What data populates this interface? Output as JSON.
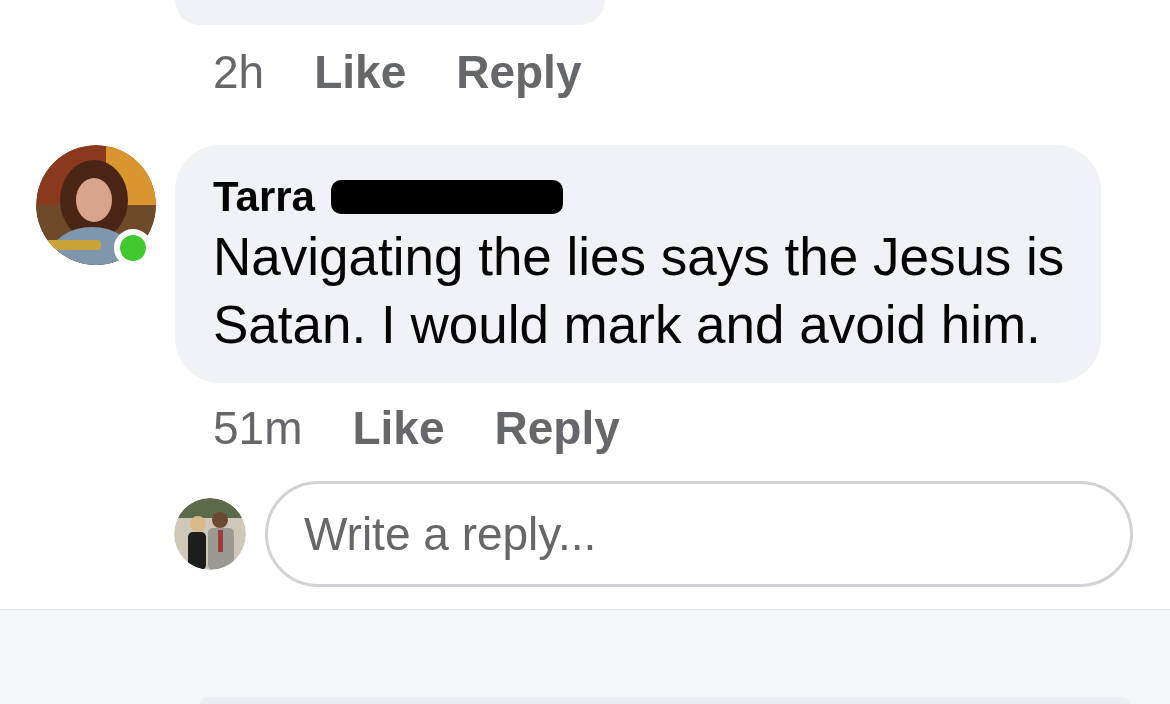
{
  "previous_comment": {
    "time": "2h",
    "actions": [
      "Like",
      "Reply"
    ]
  },
  "comment": {
    "author": "Tarra",
    "author_redacted": true,
    "online": true,
    "text": "Navigating the lies says the Jesus is Satan. I would mark and avoid him.",
    "time": "51m",
    "actions": [
      "Like",
      "Reply"
    ]
  },
  "reply_field": {
    "placeholder": "Write a reply..."
  }
}
